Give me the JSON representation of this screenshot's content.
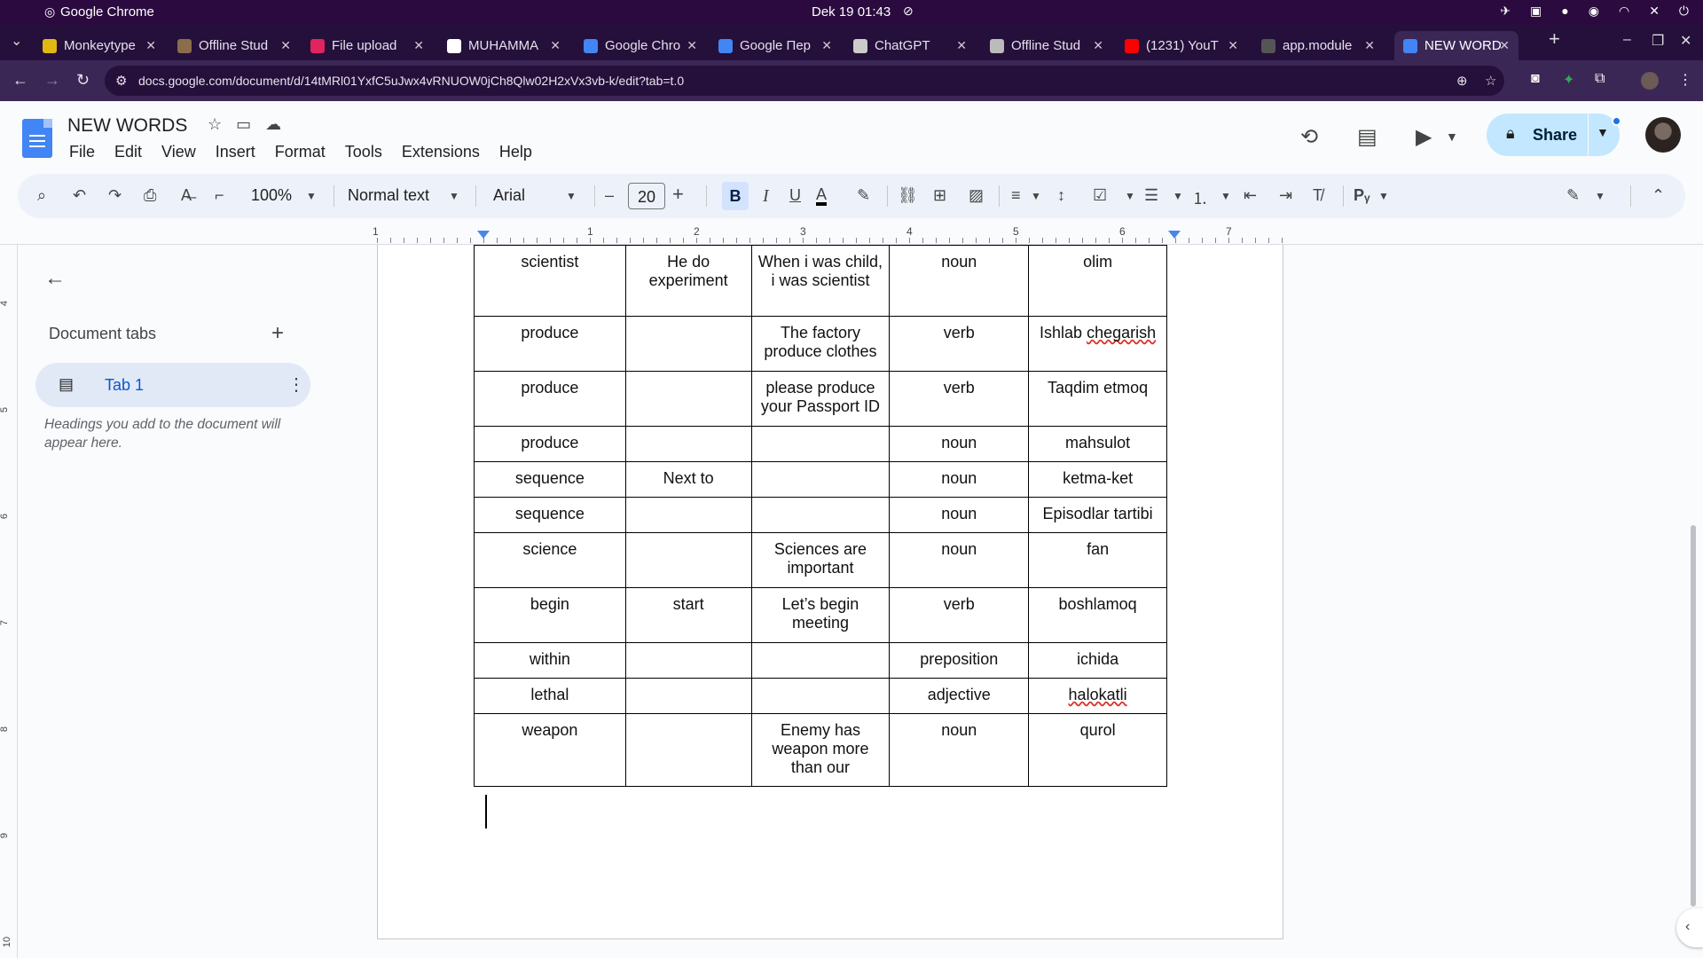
{
  "os": {
    "app_name": "Google Chrome",
    "clock": "Dek 19  01:43"
  },
  "tabs": [
    {
      "title": "Monkeytype",
      "color": "#e2b714"
    },
    {
      "title": "Offline Stud",
      "color": "#8a6d4a"
    },
    {
      "title": "File upload",
      "color": "#e0245e"
    },
    {
      "title": "MUHAMMA",
      "color": "#ffffff"
    },
    {
      "title": "Google Chro",
      "color": "#4285f4"
    },
    {
      "title": "Google Пер",
      "color": "#4285f4"
    },
    {
      "title": "ChatGPT",
      "color": "#cccccc"
    },
    {
      "title": "Offline Stud",
      "color": "#bbbbbb"
    },
    {
      "title": "(1231) YouT",
      "color": "#ff0000"
    },
    {
      "title": "app.module",
      "color": "#555555"
    },
    {
      "title": "NEW WORD",
      "color": "#4285f4",
      "active": true
    }
  ],
  "address": {
    "url": "docs.google.com/document/d/14tMRl01YxfC5uJwx4vRNUOW0jCh8Qlw02H2xVx3vb-k/edit?tab=t.0"
  },
  "doc": {
    "title": "NEW WORDS",
    "menu": [
      "File",
      "Edit",
      "View",
      "Insert",
      "Format",
      "Tools",
      "Extensions",
      "Help"
    ],
    "share_label": "Share"
  },
  "toolbar": {
    "zoom": "100%",
    "style": "Normal text",
    "font": "Arial",
    "font_size": "20",
    "bold": "B",
    "italic": "I",
    "underline": "U"
  },
  "ruler": {
    "numbers": [
      "1",
      "1",
      "2",
      "3",
      "4",
      "5",
      "6",
      "7"
    ],
    "vertical_numbers": [
      "4",
      "5",
      "6",
      "7",
      "8",
      "9",
      "10"
    ]
  },
  "sidebar": {
    "title": "Document tabs",
    "tab_label": "Tab 1",
    "hint": "Headings you add to the document will appear here."
  },
  "table": {
    "rows": [
      [
        "scientist",
        "He do experiment",
        "When i was child, i was scientist",
        "noun",
        "olim"
      ],
      [
        "produce",
        "",
        "The factory produce clothes",
        "verb",
        "Ishlab chegarish"
      ],
      [
        "produce",
        "",
        "please  produce your Passport ID",
        "verb",
        "Taqdim etmoq"
      ],
      [
        "produce",
        "",
        "",
        "noun",
        "mahsulot"
      ],
      [
        "sequence",
        "Next to",
        "",
        "noun",
        "ketma-ket"
      ],
      [
        "sequence",
        "",
        "",
        "noun",
        "Episodlar tartibi"
      ],
      [
        "science",
        "",
        "Sciences are important",
        "noun",
        "fan"
      ],
      [
        "begin",
        "start",
        "Let’s begin meeting",
        "verb",
        "boshlamoq"
      ],
      [
        "within",
        "",
        "",
        "preposition",
        "ichida"
      ],
      [
        "lethal",
        "",
        "",
        "adjective",
        "halokatli"
      ],
      [
        "weapon",
        "",
        "Enemy has weapon more than our",
        "noun",
        "qurol"
      ]
    ]
  },
  "colors": {
    "chrome_dark": "#24103a",
    "chrome_mid": "#3a2756",
    "share_bg": "#c2e7ff",
    "accent": "#0b57d0"
  }
}
